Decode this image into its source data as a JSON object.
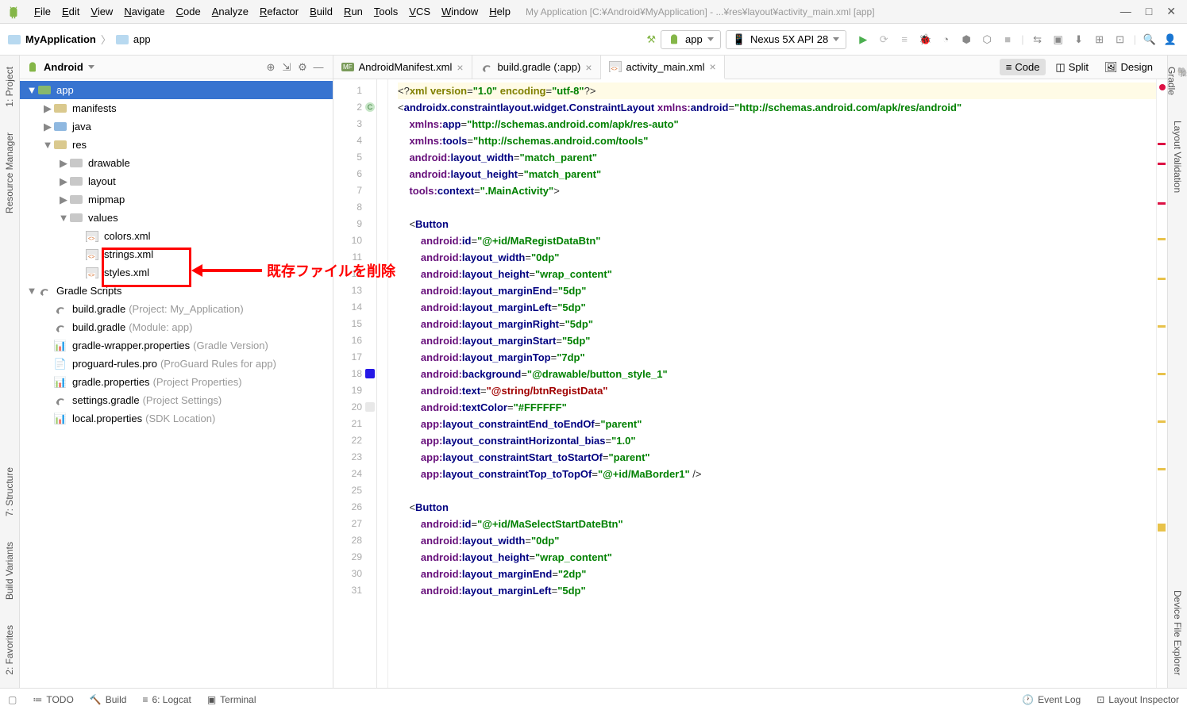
{
  "menu": {
    "items": [
      "File",
      "Edit",
      "View",
      "Navigate",
      "Code",
      "Analyze",
      "Refactor",
      "Build",
      "Run",
      "Tools",
      "VCS",
      "Window",
      "Help"
    ],
    "title": "My Application [C:¥Android¥MyApplication] - ...¥res¥layout¥activity_main.xml [app]"
  },
  "crumbs": {
    "items": [
      "MyApplication",
      "app"
    ]
  },
  "run_config": {
    "app": "app",
    "device": "Nexus 5X API 28"
  },
  "project_header": {
    "title": "Android"
  },
  "tree": {
    "app": "app",
    "manifests": "manifests",
    "java": "java",
    "res": "res",
    "drawable": "drawable",
    "layout": "layout",
    "mipmap": "mipmap",
    "values": "values",
    "colors": "colors.xml",
    "strings": "strings.xml",
    "styles": "styles.xml",
    "gradle_scripts": "Gradle Scripts",
    "bg1": "build.gradle",
    "bg1_dim": "(Project: My_Application)",
    "bg2": "build.gradle",
    "bg2_dim": "(Module: app)",
    "gw": "gradle-wrapper.properties",
    "gw_dim": "(Gradle Version)",
    "pg": "proguard-rules.pro",
    "pg_dim": "(ProGuard Rules for app)",
    "gp": "gradle.properties",
    "gp_dim": "(Project Properties)",
    "sg": "settings.gradle",
    "sg_dim": "(Project Settings)",
    "lp": "local.properties",
    "lp_dim": "(SDK Location)"
  },
  "annotation": "既存ファイルを削除",
  "editor_tabs": [
    {
      "name": "AndroidManifest.xml",
      "active": false,
      "icon": "mf"
    },
    {
      "name": "build.gradle (:app)",
      "active": false,
      "icon": "gradle"
    },
    {
      "name": "activity_main.xml",
      "active": true,
      "icon": "xml"
    }
  ],
  "view_switch": {
    "code": "Code",
    "split": "Split",
    "design": "Design"
  },
  "left_strip": [
    "1: Project",
    "Resource Manager",
    "7: Structure",
    "Build Variants",
    "2: Favorites"
  ],
  "right_strip": [
    "Gradle",
    "Layout Validation",
    "Device File Explorer"
  ],
  "status": {
    "todo": "TODO",
    "build": "Build",
    "logcat": "6: Logcat",
    "terminal": "Terminal",
    "event_log": "Event Log",
    "layout_inspector": "Layout Inspector"
  },
  "code_lines": [
    {
      "n": 1,
      "hl": 1,
      "html": "<span class='t-punct'>&lt;?</span><span class='t-decl'>xml version</span><span class='t-punct'>=</span><span class='t-val'>\"1.0\"</span> <span class='t-decl'>encoding</span><span class='t-punct'>=</span><span class='t-val'>\"utf-8\"</span><span class='t-punct'>?&gt;</span>"
    },
    {
      "n": 2,
      "marker": "c",
      "html": "<span class='t-punct'>&lt;</span><span class='t-tag'>androidx.constraintlayout.widget.ConstraintLayout</span> <span class='t-ns'>xmlns:</span><span class='t-attr'>android</span><span class='t-punct'>=</span><span class='t-val'>\"http://schemas.android.com/apk/res/android\"</span>"
    },
    {
      "n": 3,
      "html": "    <span class='t-ns'>xmlns:</span><span class='t-attr'>app</span><span class='t-punct'>=</span><span class='t-val'>\"http://schemas.android.com/apk/res-auto\"</span>"
    },
    {
      "n": 4,
      "html": "    <span class='t-ns'>xmlns:</span><span class='t-attr'>tools</span><span class='t-punct'>=</span><span class='t-val'>\"http://schemas.android.com/tools\"</span>"
    },
    {
      "n": 5,
      "html": "    <span class='t-ns'>android:</span><span class='t-attr'>layout_width</span><span class='t-punct'>=</span><span class='t-val'>\"match_parent\"</span>"
    },
    {
      "n": 6,
      "html": "    <span class='t-ns'>android:</span><span class='t-attr'>layout_height</span><span class='t-punct'>=</span><span class='t-val'>\"match_parent\"</span>"
    },
    {
      "n": 7,
      "html": "    <span class='t-ns'>tools:</span><span class='t-attr'>context</span><span class='t-punct'>=</span><span class='t-val'>\".MainActivity\"</span><span class='t-punct'>&gt;</span>"
    },
    {
      "n": 8,
      "html": ""
    },
    {
      "n": 9,
      "html": "    <span class='t-punct'>&lt;</span><span class='t-tag'>Button</span>"
    },
    {
      "n": 10,
      "html": "        <span class='t-ns'>android:</span><span class='t-attr'>id</span><span class='t-punct'>=</span><span class='t-val'>\"@+id/MaRegistDataBtn\"</span>"
    },
    {
      "n": 11,
      "html": "        <span class='t-ns'>android:</span><span class='t-attr'>layout_width</span><span class='t-punct'>=</span><span class='t-val'>\"0dp\"</span>"
    },
    {
      "n": 12,
      "html": "        <span class='t-ns'>android:</span><span class='t-attr'>layout_height</span><span class='t-punct'>=</span><span class='t-val'>\"wrap_content\"</span>"
    },
    {
      "n": 13,
      "html": "        <span class='t-ns'>android:</span><span class='t-attr'>layout_marginEnd</span><span class='t-punct'>=</span><span class='t-val'>\"5dp\"</span>"
    },
    {
      "n": 14,
      "html": "        <span class='t-ns'>android:</span><span class='t-attr'>layout_marginLeft</span><span class='t-punct'>=</span><span class='t-val'>\"5dp\"</span>"
    },
    {
      "n": 15,
      "html": "        <span class='t-ns'>android:</span><span class='t-attr'>layout_marginRight</span><span class='t-punct'>=</span><span class='t-val'>\"5dp\"</span>"
    },
    {
      "n": 16,
      "html": "        <span class='t-ns'>android:</span><span class='t-attr'>layout_marginStart</span><span class='t-punct'>=</span><span class='t-val'>\"5dp\"</span>"
    },
    {
      "n": 17,
      "html": "        <span class='t-ns'>android:</span><span class='t-attr'>layout_marginTop</span><span class='t-punct'>=</span><span class='t-val'>\"7dp\"</span>"
    },
    {
      "n": 18,
      "marker": "sq",
      "html": "        <span class='t-ns'>android:</span><span class='t-attr'>background</span><span class='t-punct'>=</span><span class='t-val'>\"@drawable/button_style_1\"</span>"
    },
    {
      "n": 19,
      "html": "        <span class='t-ns'>android:</span><span class='t-attr'>text</span><span class='t-punct'>=</span><span class='t-val-red'>\"@string/btnRegistData\"</span>"
    },
    {
      "n": 20,
      "marker": "empty",
      "html": "        <span class='t-ns'>android:</span><span class='t-attr'>textColor</span><span class='t-punct'>=</span><span class='t-val'>\"#FFFFFF\"</span>"
    },
    {
      "n": 21,
      "html": "        <span class='t-ns'>app:</span><span class='t-attr'>layout_constraintEnd_toEndOf</span><span class='t-punct'>=</span><span class='t-val'>\"parent\"</span>"
    },
    {
      "n": 22,
      "html": "        <span class='t-ns'>app:</span><span class='t-attr'>layout_constraintHorizontal_bias</span><span class='t-punct'>=</span><span class='t-val'>\"1.0\"</span>"
    },
    {
      "n": 23,
      "html": "        <span class='t-ns'>app:</span><span class='t-attr'>layout_constraintStart_toStartOf</span><span class='t-punct'>=</span><span class='t-val'>\"parent\"</span>"
    },
    {
      "n": 24,
      "html": "        <span class='t-ns'>app:</span><span class='t-attr'>layout_constraintTop_toTopOf</span><span class='t-punct'>=</span><span class='t-val'>\"@+id/MaBorder1\"</span> <span class='t-punct'>/&gt;</span>"
    },
    {
      "n": 25,
      "html": ""
    },
    {
      "n": 26,
      "html": "    <span class='t-punct'>&lt;</span><span class='t-tag'>Button</span>"
    },
    {
      "n": 27,
      "html": "        <span class='t-ns'>android:</span><span class='t-attr'>id</span><span class='t-punct'>=</span><span class='t-val'>\"@+id/MaSelectStartDateBtn\"</span>"
    },
    {
      "n": 28,
      "html": "        <span class='t-ns'>android:</span><span class='t-attr'>layout_width</span><span class='t-punct'>=</span><span class='t-val'>\"0dp\"</span>"
    },
    {
      "n": 29,
      "html": "        <span class='t-ns'>android:</span><span class='t-attr'>layout_height</span><span class='t-punct'>=</span><span class='t-val'>\"wrap_content\"</span>"
    },
    {
      "n": 30,
      "html": "        <span class='t-ns'>android:</span><span class='t-attr'>layout_marginEnd</span><span class='t-punct'>=</span><span class='t-val'>\"2dp\"</span>"
    },
    {
      "n": 31,
      "html": "        <span class='t-ns'>android:</span><span class='t-attr'>layout_marginLeft</span><span class='t-punct'>=</span><span class='t-val'>\"5dp\"</span>"
    }
  ]
}
